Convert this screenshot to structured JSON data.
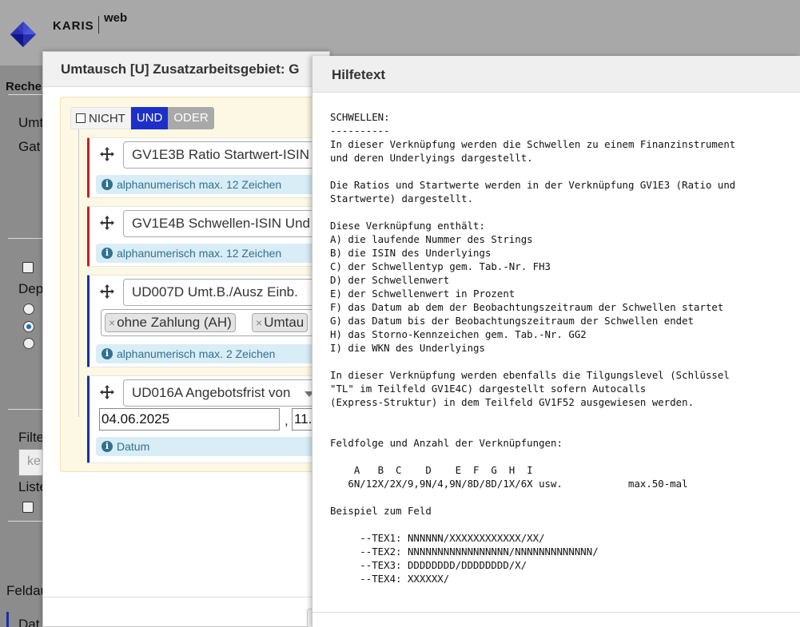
{
  "app": {
    "brand": "KARIS",
    "brand_suffix": "web"
  },
  "background_page": {
    "texts": [
      "Reche",
      "Umt",
      "Gat",
      "Dep",
      "Filte",
      "ke",
      "Liste",
      "Feldau",
      "Dat"
    ]
  },
  "dialog": {
    "title": "Umtausch [U] Zusatzarbeitsgebiet: G",
    "condition": {
      "not_label": "NICHT",
      "and_label": "UND",
      "or_label": "ODER",
      "active": "UND"
    },
    "rules": [
      {
        "field": "GV1E3B Ratio Startwert-ISIN",
        "hint": "alphanumerisch max. 12 Zeichen"
      },
      {
        "field": "GV1E4B Schwellen-ISIN Und",
        "hint": "alphanumerisch max. 12 Zeichen"
      },
      {
        "field": "UD007D Umt.B./Ausz Einb.",
        "tags": [
          "ohne Zahlung (AH)",
          "Umtau"
        ],
        "hint": "alphanumerisch max. 2 Zeichen"
      },
      {
        "field": "UD016A Angebotsfrist von",
        "date_from": "04.06.2025",
        "separator": ",",
        "date_to": "11.",
        "hint": "Datum"
      }
    ]
  },
  "help_panel": {
    "title": "Hilfetext",
    "body": "SCHWELLEN:\n----------\nIn dieser Verknüpfung werden die Schwellen zu einem Finanzinstrument\nund deren Underlyings dargestellt.\n\nDie Ratios und Startwerte werden in der Verknüpfung GV1E3 (Ratio und\nStartwerte) dargestellt.\n\nDiese Verknüpfung enthält:\nA) die laufende Nummer des Strings\nB) die ISIN des Underlyings\nC) der Schwellentyp gem. Tab.-Nr. FH3\nD) der Schwellenwert\nE) der Schwellenwert in Prozent\nF) das Datum ab dem der Beobachtungszeitraum der Schwellen startet\nG) das Datum bis der Beobachtungszeitraum der Schwellen endet\nH) das Storno-Kennzeichen gem. Tab.-Nr. GG2\nI) die WKN des Underlyings\n\nIn dieser Verknüpfung werden ebenfalls die Tilgungslevel (Schlüssel\n\"TL\" im Teilfeld GV1E4C) dargestellt sofern Autocalls\n(Express-Struktur) in dem Teilfeld GV1F52 ausgewiesen werden.\n\n\nFeldfolge und Anzahl der Verknüpfungen:\n\n    A   B  C    D    E  F  G  H  I\n   6N/12X/2X/9,9N/4,9N/8D/8D/1X/6X usw.           max.50-mal\n\nBeispiel zum Feld\n\n     --TEX1: NNNNNN/XXXXXXXXXXXX/XX/\n     --TEX2: NNNNNNNNNNNNNNNNN/NNNNNNNNNNNNN/\n     --TEX3: DDDDDDDD/DDDDDDDD/X/\n     --TEX4: XXXXXX/"
  },
  "colors": {
    "and_active": "#1c2fc9",
    "or_inactive": "#a9a9a9",
    "rule_red": "#c62020",
    "rule_blue": "#1a2ea8",
    "hint_bg": "#d9edf7",
    "hint_text": "#31708f",
    "builder_bg": "#fcf8e3"
  },
  "icons": {
    "logo": "karis-diamond-logo",
    "drag": "move-arrows-icon",
    "info": "info-circle-icon",
    "remove_tag": "close-x-icon",
    "caret": "chevron-down-icon"
  }
}
